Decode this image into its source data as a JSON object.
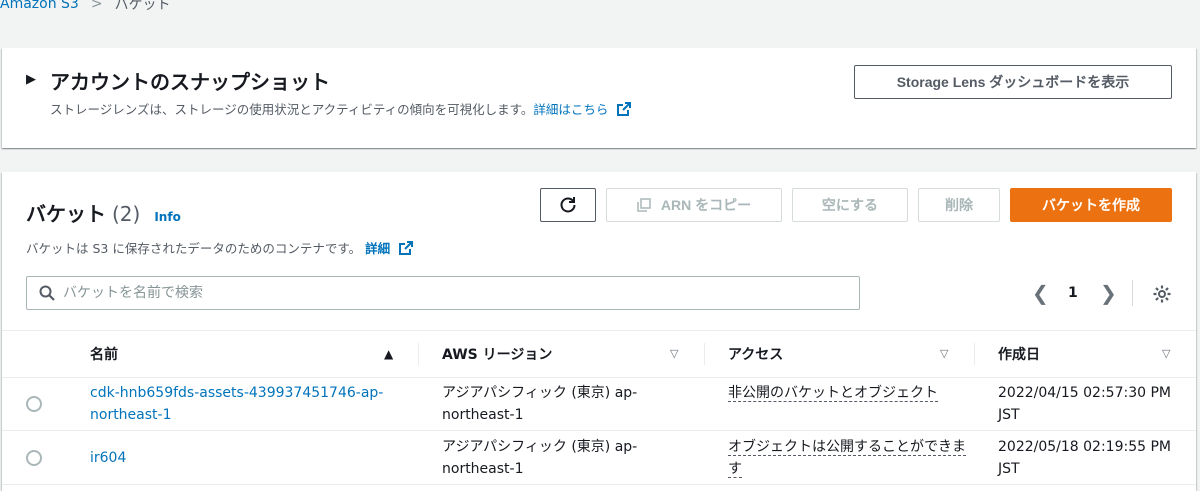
{
  "breadcrumb": {
    "root": "Amazon S3",
    "current": "バケット"
  },
  "snapshot": {
    "title": "アカウントのスナップショット",
    "description": "ストレージレンズは、ストレージの使用状況とアクティビティの傾向を可視化します。",
    "learn_more": "詳細はこちら",
    "dashboard_button": "Storage Lens ダッシュボードを表示"
  },
  "buckets": {
    "title": "バケット",
    "count": "(2)",
    "info": "Info",
    "description": "バケットは S3 に保存されたデータのためのコンテナです。",
    "details_link": "詳細",
    "buttons": {
      "copy_arn": "ARN をコピー",
      "empty": "空にする",
      "delete": "削除",
      "create": "バケットを作成"
    },
    "search_placeholder": "バケットを名前で検索",
    "page": "1",
    "columns": {
      "name": "名前",
      "region": "AWS リージョン",
      "access": "アクセス",
      "created": "作成日"
    },
    "rows": [
      {
        "name": "cdk-hnb659fds-assets-439937451746-ap-northeast-1",
        "region": "アジアパシフィック (東京) ap-northeast-1",
        "access": "非公開のバケットとオブジェクト",
        "created": "2022/04/15 02:57:30 PM JST"
      },
      {
        "name": "ir604",
        "region": "アジアパシフィック (東京) ap-northeast-1",
        "access": "オブジェクトは公開することができます",
        "created": "2022/05/18 02:19:55 PM JST"
      }
    ]
  },
  "colors": {
    "link": "#0073bb",
    "primary_button": "#ec7211"
  },
  "icons": [
    "caret-right-icon",
    "external-link-icon",
    "refresh-icon",
    "copy-icon",
    "search-icon",
    "chevron-left-icon",
    "chevron-right-icon",
    "gear-icon",
    "sort-ascending-icon",
    "sort-icon"
  ]
}
